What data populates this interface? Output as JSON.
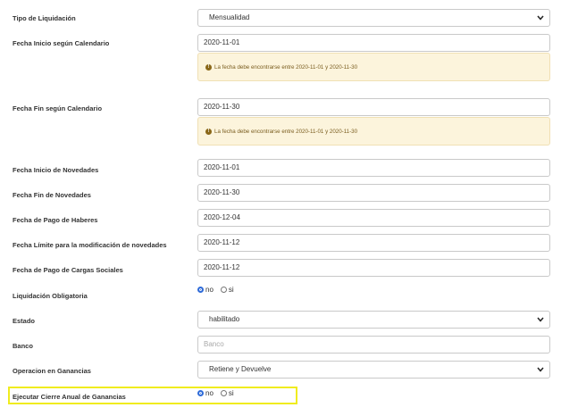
{
  "fields": {
    "tipo_liquidacion": {
      "label": "Tipo de Liquidación",
      "value": "Mensualidad"
    },
    "fecha_inicio_calendario": {
      "label": "Fecha Inicio según Calendario",
      "value": "2020-11-01",
      "alert": "La fecha debe encontrarse entre 2020-11-01 y 2020-11-30"
    },
    "fecha_fin_calendario": {
      "label": "Fecha Fin según Calendario",
      "value": "2020-11-30",
      "alert": "La fecha debe encontrarse entre 2020-11-01 y 2020-11-30"
    },
    "fecha_inicio_novedades": {
      "label": "Fecha Inicio de Novedades",
      "value": "2020-11-01"
    },
    "fecha_fin_novedades": {
      "label": "Fecha Fin de Novedades",
      "value": "2020-11-30"
    },
    "fecha_pago_haberes": {
      "label": "Fecha de Pago de Haberes",
      "value": "2020-12-04"
    },
    "fecha_limite_novedades": {
      "label": "Fecha Límite para la modificación de novedades",
      "value": "2020-11-12"
    },
    "fecha_pago_cargas": {
      "label": "Fecha de Pago de Cargas Sociales",
      "value": "2020-11-12"
    },
    "liquidacion_obligatoria": {
      "label": "Liquidación Obligatoria",
      "option_no": "no",
      "option_si": "si",
      "selected": "no"
    },
    "estado": {
      "label": "Estado",
      "value": "habilitado"
    },
    "banco": {
      "label": "Banco",
      "placeholder": "Banco"
    },
    "operacion_ganancias": {
      "label": "Operacion en Ganancias",
      "value": "Retiene y Devuelve"
    },
    "ejecutar_cierre": {
      "label": "Ejecutar Cierre Anual de Ganancias",
      "option_no": "no",
      "option_si": "si",
      "selected": "no"
    }
  },
  "colors": {
    "highlight": "#f0ec1f",
    "alert_bg": "#fcf4dc",
    "radio_selected": "#2f6bd8"
  },
  "icons": {
    "alert": "exclamation-circle-icon",
    "select": "chevron-down-icon"
  }
}
